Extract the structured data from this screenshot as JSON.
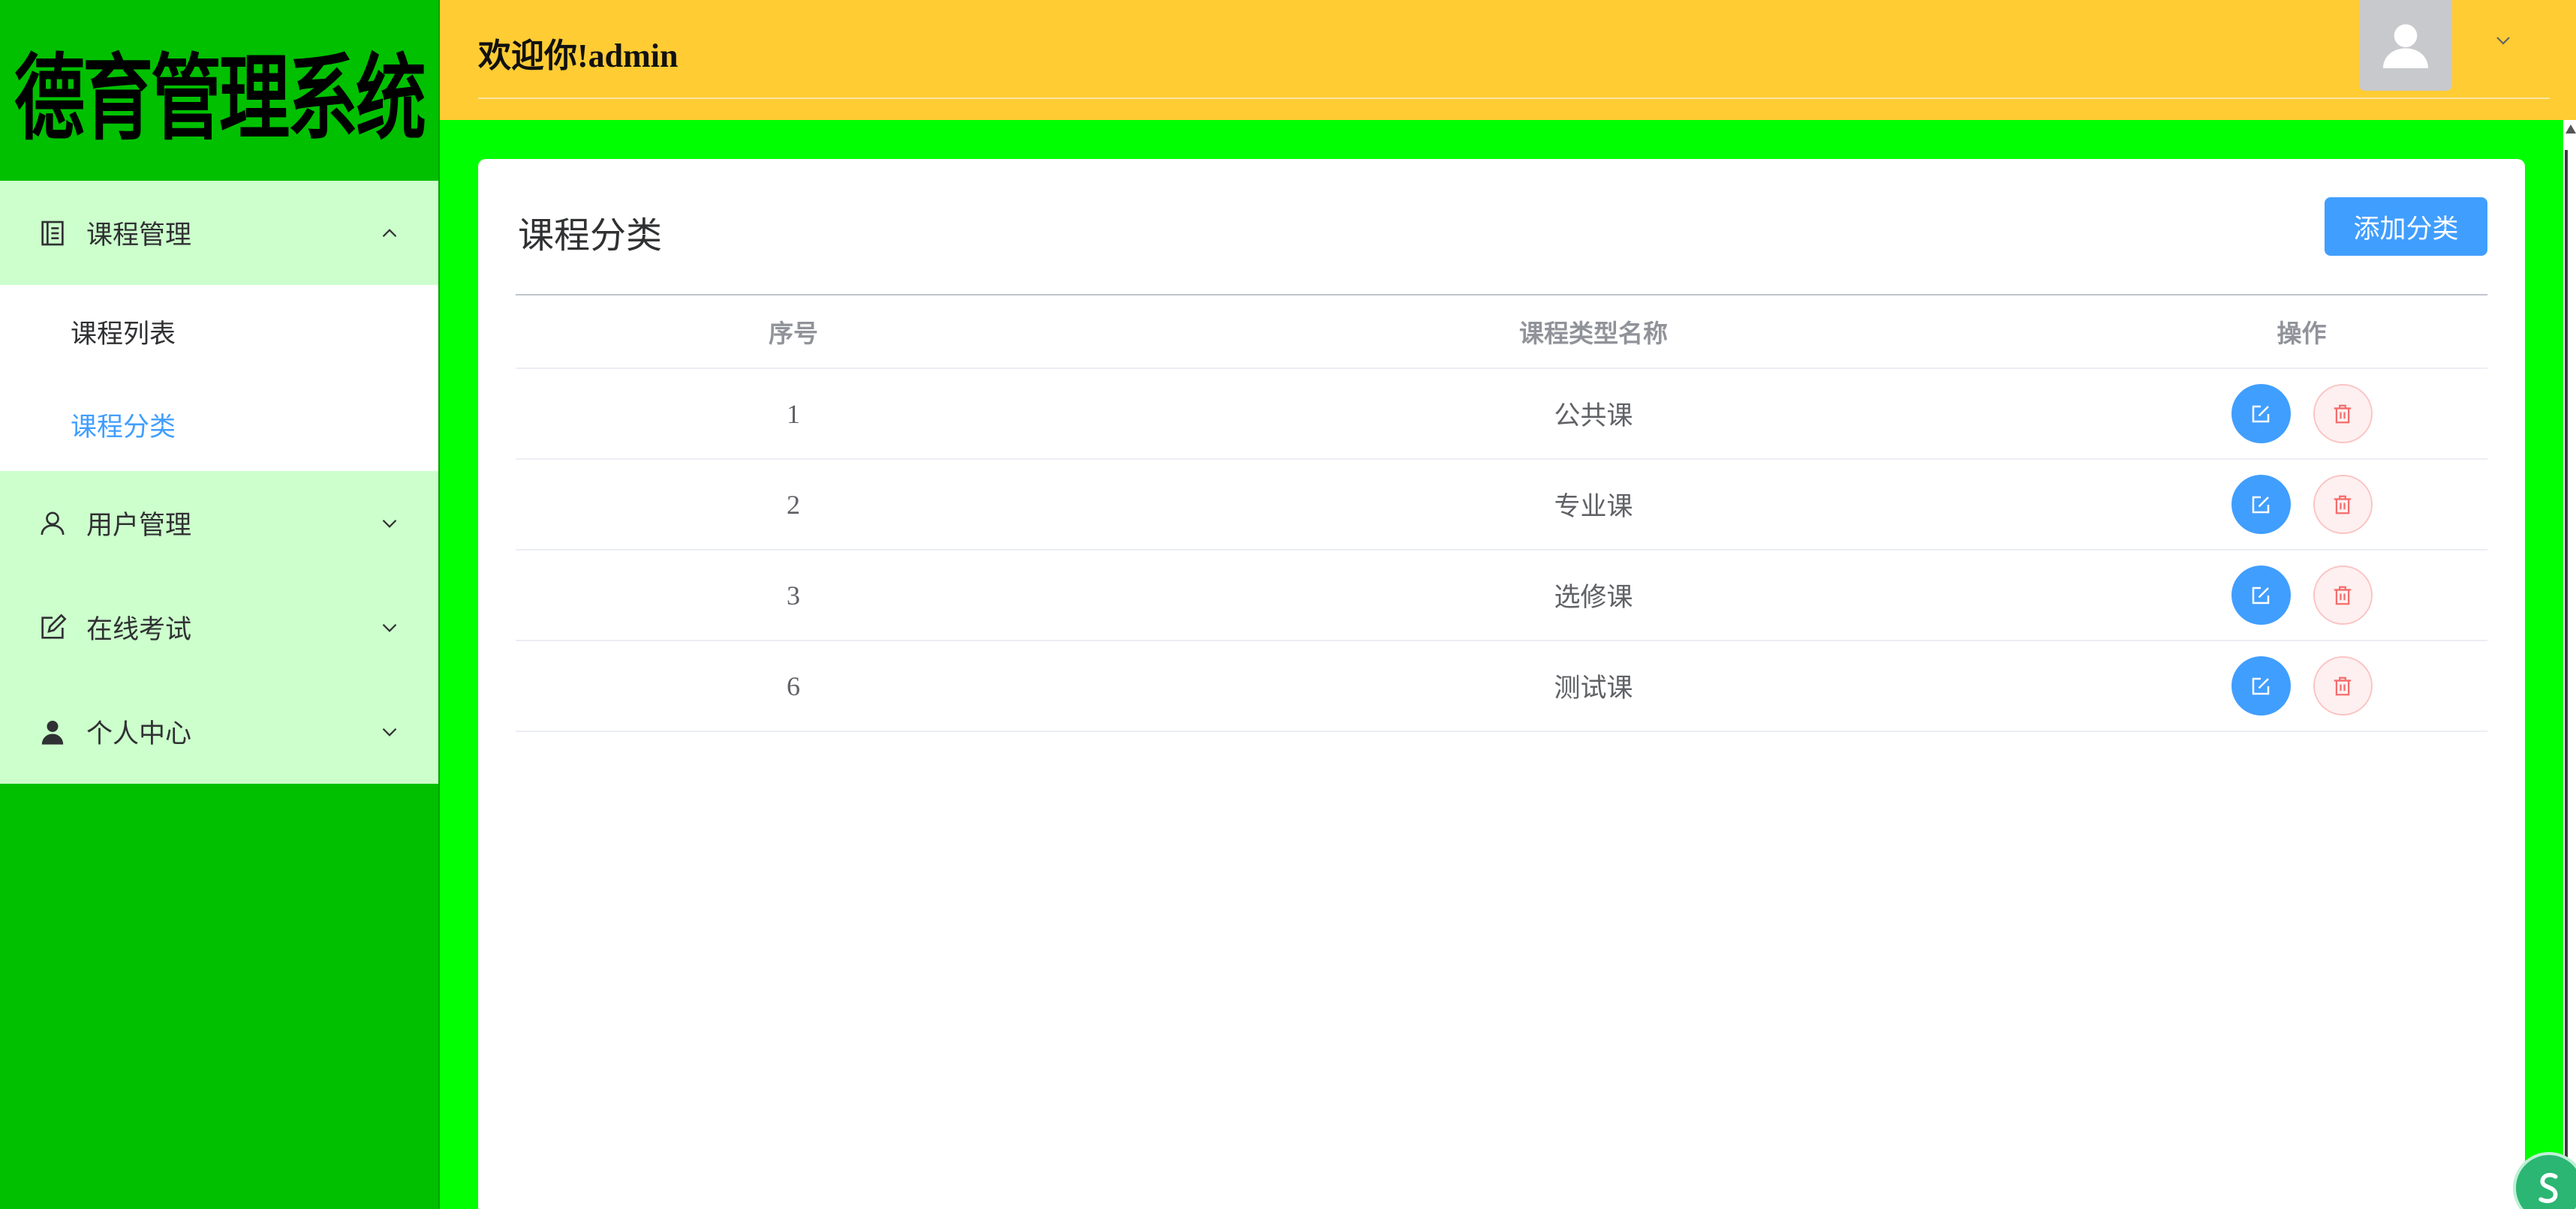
{
  "sidebar": {
    "logo": "德育管理系统",
    "menu": [
      {
        "label": "课程管理",
        "icon": "document-icon",
        "expanded": true,
        "children": [
          {
            "label": "课程列表",
            "active": false
          },
          {
            "label": "课程分类",
            "active": true
          }
        ]
      },
      {
        "label": "用户管理",
        "icon": "user-outline-icon",
        "expanded": false
      },
      {
        "label": "在线考试",
        "icon": "edit-square-icon",
        "expanded": false
      },
      {
        "label": "个人中心",
        "icon": "user-filled-icon",
        "expanded": false
      }
    ]
  },
  "header": {
    "welcome": "欢迎你!admin",
    "avatar_icon": "user-avatar-icon",
    "dropdown_icon": "chevron-down-icon"
  },
  "page": {
    "title": "课程分类",
    "add_button": "添加分类"
  },
  "table": {
    "columns": [
      "序号",
      "课程类型名称",
      "操作"
    ],
    "rows": [
      {
        "index": "1",
        "name": "公共课"
      },
      {
        "index": "2",
        "name": "专业课"
      },
      {
        "index": "3",
        "name": "选修课"
      },
      {
        "index": "6",
        "name": "测试课"
      }
    ],
    "row_actions": {
      "edit_icon": "edit-icon",
      "delete_icon": "delete-icon"
    }
  },
  "colors": {
    "sidebar_bg": "#00c000",
    "menu_bg": "#ccffcc",
    "header_bg": "#ffcc33",
    "main_bg": "#00ff00",
    "accent": "#409eff",
    "danger": "#f56c6c"
  }
}
